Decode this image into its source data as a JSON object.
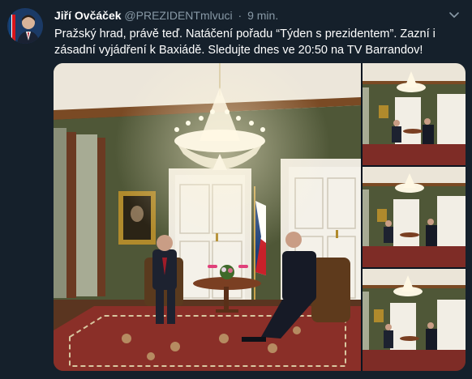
{
  "tweet": {
    "author_name": "Jiří Ovčáček",
    "author_handle": "@PREZIDENTmlvuci",
    "separator": "·",
    "timestamp": "9 min.",
    "text": "Pražský hrad, právě teď. Natáčení pořadu “Týden s prezidentem”. Zazní i zásadní vyjádření k Baxiádě. Sledujte dnes ve 20:50 na TV Barrandov!"
  },
  "icons": {
    "avatar": "profile-avatar",
    "menu": "chevron-down-icon"
  },
  "colors": {
    "background": "#15202b",
    "text_primary": "#ffffff",
    "text_secondary": "#8899a6",
    "wall_green": "#4a5234",
    "wood_trim": "#7a4a2a",
    "rug_red": "#8a2f28"
  },
  "media": {
    "photo_count": 4
  }
}
